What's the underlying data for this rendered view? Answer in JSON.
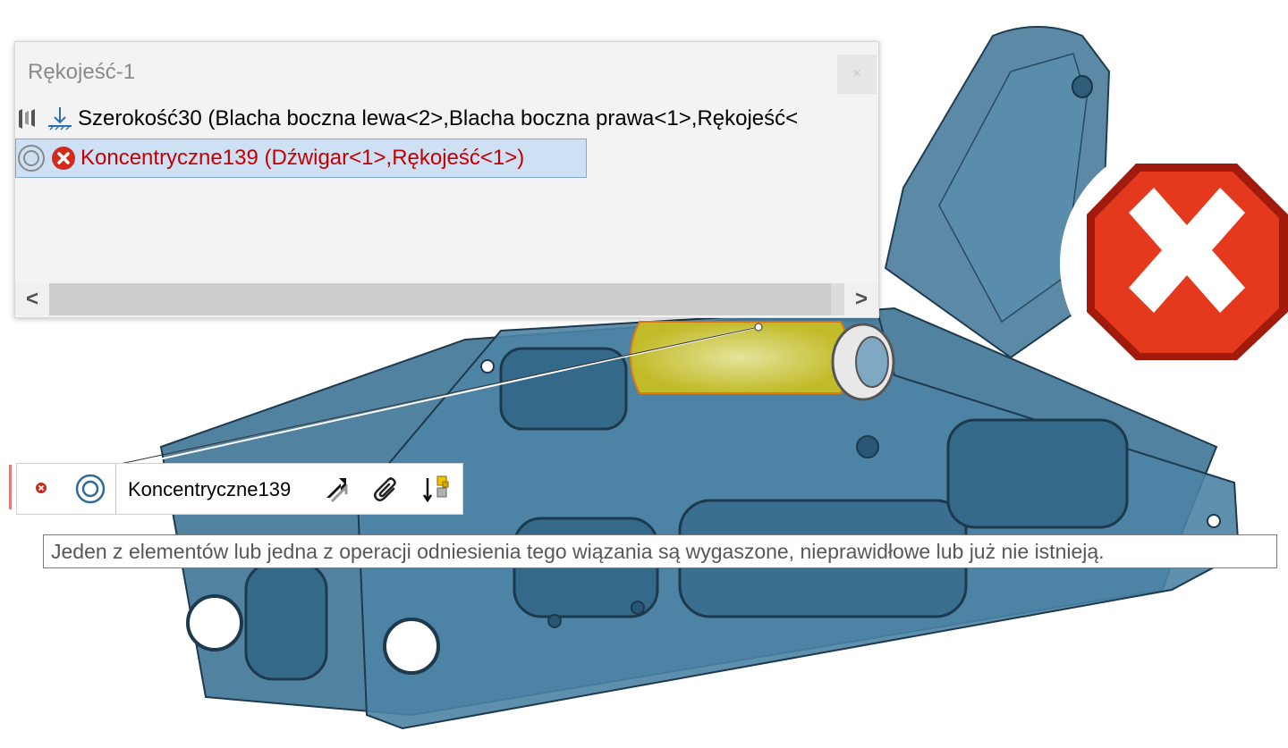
{
  "panel": {
    "title": "Rękojeść-1",
    "close_label": "×",
    "rows": [
      {
        "text": "Szerokość30 (Blacha boczna lewa<2>,Blacha boczna prawa<1>,Rękojeść<",
        "icon": "width-mate-icon",
        "status_icon": "fixed-ground-icon",
        "state": "normal"
      },
      {
        "text": "Koncentryczne139 (Dźwigar<1>,Rękojeść<1>)",
        "icon": "concentric-mate-icon",
        "status_icon": "error-icon",
        "state": "error-selected"
      }
    ],
    "scroll_left": "<",
    "scroll_right": ">"
  },
  "context_toolbar": {
    "mate_name": "Koncentryczne139",
    "icons": [
      "error-icon",
      "concentric-mate-icon",
      "flip-alignment-icon",
      "paperclip-icon",
      "mate-order-icon"
    ]
  },
  "tooltip": {
    "text": "Jeden z elementów lub jedna z operacji odniesienia tego wiązania są wygaszone, nieprawidłowe lub już nie istnieją."
  },
  "colors": {
    "error_red": "#c40000",
    "selection_blue": "#cde0f4",
    "part_blue": "#4a7d9c",
    "highlight_yellow": "#e6d21a"
  }
}
